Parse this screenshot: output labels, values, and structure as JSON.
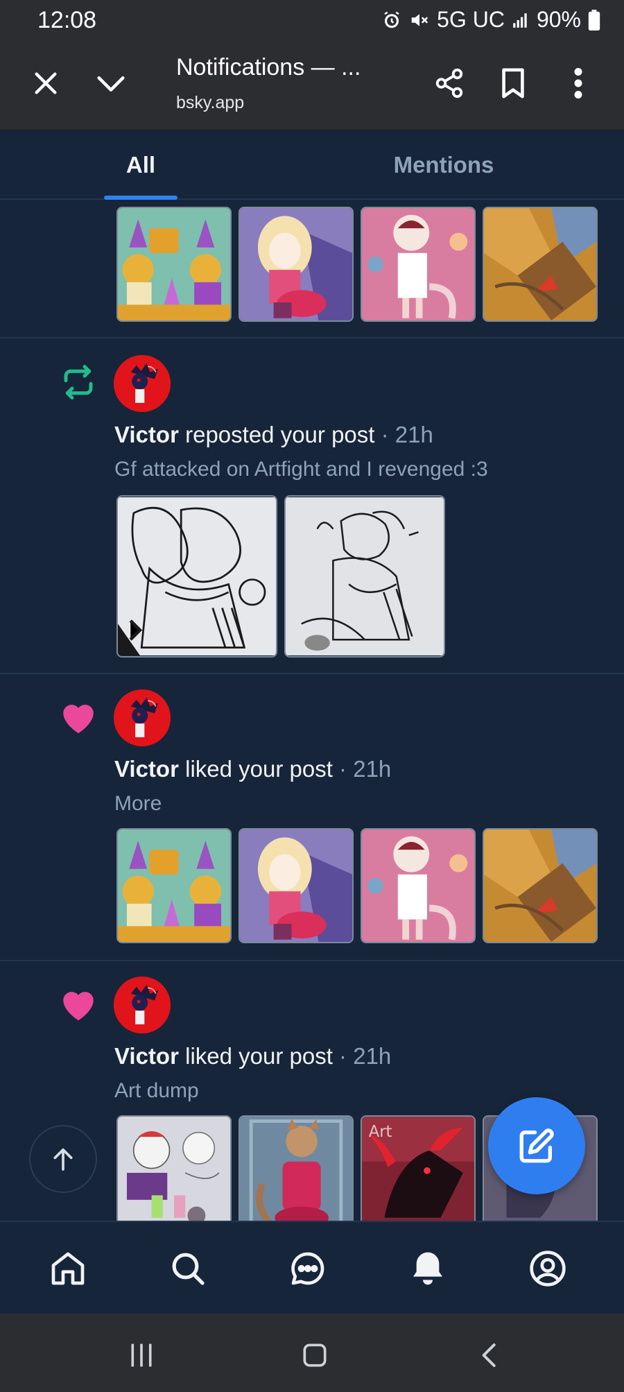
{
  "status_bar": {
    "time": "12:08",
    "network": "5G UC",
    "battery": "90%"
  },
  "browser": {
    "title": "Notifications — ...",
    "url": "bsky.app",
    "icons": [
      "close-icon",
      "chevron-down-icon",
      "share-icon",
      "bookmark-icon",
      "more-vertical-icon"
    ]
  },
  "tabs": [
    {
      "label": "All",
      "selected": true
    },
    {
      "label": "Mentions",
      "selected": false
    }
  ],
  "notifications": [
    {
      "type": "repost",
      "icon": "repost-icon",
      "user": "Victor",
      "action": "reposted your post",
      "time": "21h",
      "post_text": "Gf attacked on Artfight and I revenged :3",
      "image_count": 2
    },
    {
      "type": "like",
      "icon": "heart-icon",
      "user": "Victor",
      "action": "liked your post",
      "time": "21h",
      "post_text": "More",
      "image_count": 4
    },
    {
      "type": "like",
      "icon": "heart-icon",
      "user": "Victor",
      "action": "liked your post",
      "time": "21h",
      "post_text": "Art dump",
      "image_count": 4
    }
  ],
  "separator": " · ",
  "bottom_nav": [
    "home-icon",
    "search-icon",
    "chat-icon",
    "bell-icon",
    "profile-icon"
  ],
  "colors": {
    "background": "#16253a",
    "accent": "#2f82ee",
    "repost": "#20bc8c",
    "like": "#ec4899",
    "muted_text": "#8ea3b9"
  }
}
